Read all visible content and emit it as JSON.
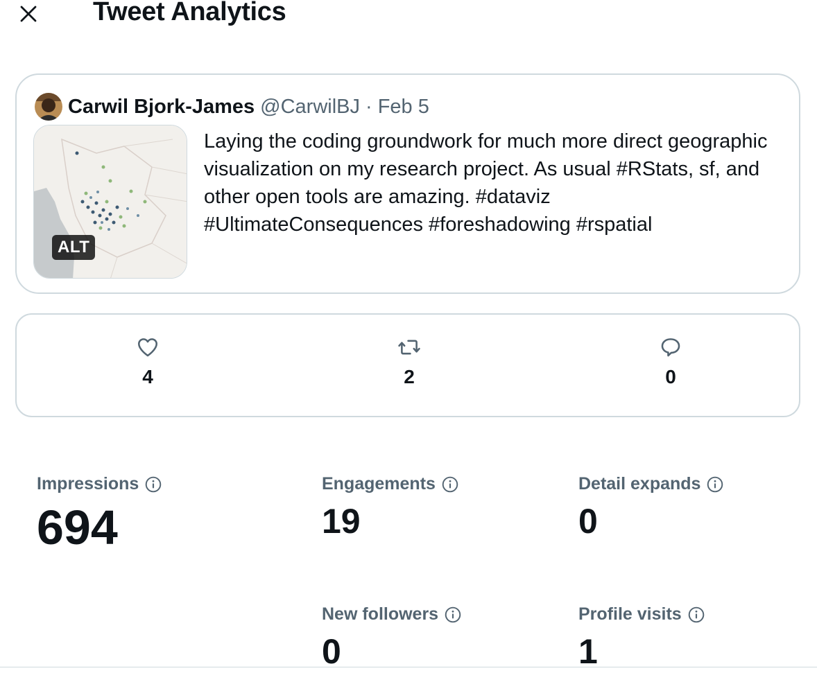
{
  "header": {
    "title": "Tweet Analytics"
  },
  "tweet": {
    "author_name": "Carwil Bjork-James",
    "author_handle": "@CarwilBJ",
    "separator": "·",
    "date": "Feb 5",
    "text": "Laying the coding groundwork for much more direct geographic visualization on my research project. As usual #RStats, sf, and other open tools are amazing. #dataviz #UltimateConsequences #foreshadowing #rspatial",
    "media_alt_badge": "ALT"
  },
  "engagement": {
    "likes": "4",
    "retweets": "2",
    "replies": "0"
  },
  "metrics": {
    "impressions": {
      "label": "Impressions",
      "value": "694"
    },
    "engagements": {
      "label": "Engagements",
      "value": "19"
    },
    "detail_expands": {
      "label": "Detail expands",
      "value": "0"
    },
    "new_followers": {
      "label": "New followers",
      "value": "0"
    },
    "profile_visits": {
      "label": "Profile visits",
      "value": "1"
    }
  },
  "icons": [
    "close-icon",
    "heart-icon",
    "retweet-icon",
    "reply-icon",
    "info-icon"
  ],
  "colors": {
    "text": "#0f1419",
    "secondary": "#536471",
    "border": "#cfd9de"
  }
}
